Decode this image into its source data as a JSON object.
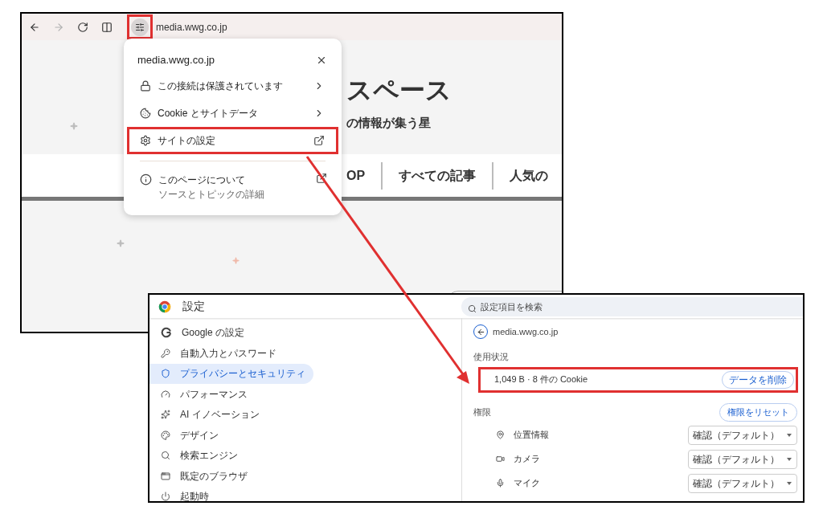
{
  "browser": {
    "toolbar": [
      {
        "kind": "back",
        "disabled": false
      },
      {
        "kind": "forward",
        "disabled": true
      },
      {
        "kind": "reload",
        "disabled": false
      },
      {
        "kind": "split",
        "disabled": false
      }
    ],
    "site_info_button": {
      "highlighted": true
    },
    "url": "media.wwg.co.jp",
    "site": {
      "title": "スペース",
      "tagline": "の情報が集う星",
      "nav": [
        "OP",
        "すべての記事",
        "人気の"
      ]
    },
    "popup": {
      "title": "media.wwg.co.jp",
      "items": [
        {
          "label": "この接続は保護されています",
          "highlighted": false
        },
        {
          "label": "Cookie とサイトデータ",
          "highlighted": false
        },
        {
          "label": "サイトの設定",
          "highlighted": true
        }
      ],
      "about": {
        "label": "このページについて",
        "subtitle": "ソースとトピックの詳細"
      }
    }
  },
  "settings": {
    "title": "設定",
    "search": {
      "placeholder": "設定項目を検索"
    },
    "sidebar": [
      {
        "label": "Google の設定",
        "selected": false
      },
      {
        "label": "自動入力とパスワード",
        "selected": false
      },
      {
        "label": "プライバシーとセキュリティ",
        "selected": true
      },
      {
        "label": "パフォーマンス",
        "selected": false
      },
      {
        "label": "AI イノベーション",
        "selected": false
      },
      {
        "label": "デザイン",
        "selected": false
      },
      {
        "label": "検索エンジン",
        "selected": false
      },
      {
        "label": "既定のブラウザ",
        "selected": false
      },
      {
        "label": "起動時",
        "selected": false
      }
    ],
    "site": "media.wwg.co.jp",
    "usage": {
      "heading": "使用状況",
      "summary": "1,049 B · 8 件の Cookie",
      "button": "データを削除",
      "highlighted": true
    },
    "permissions": {
      "heading": "権限",
      "button": "権限をリセット",
      "items": [
        {
          "label": "位置情報",
          "value": "確認（デフォルト）"
        },
        {
          "label": "カメラ",
          "value": "確認（デフォルト）"
        },
        {
          "label": "マイク",
          "value": "確認（デフォルト）"
        }
      ]
    }
  }
}
